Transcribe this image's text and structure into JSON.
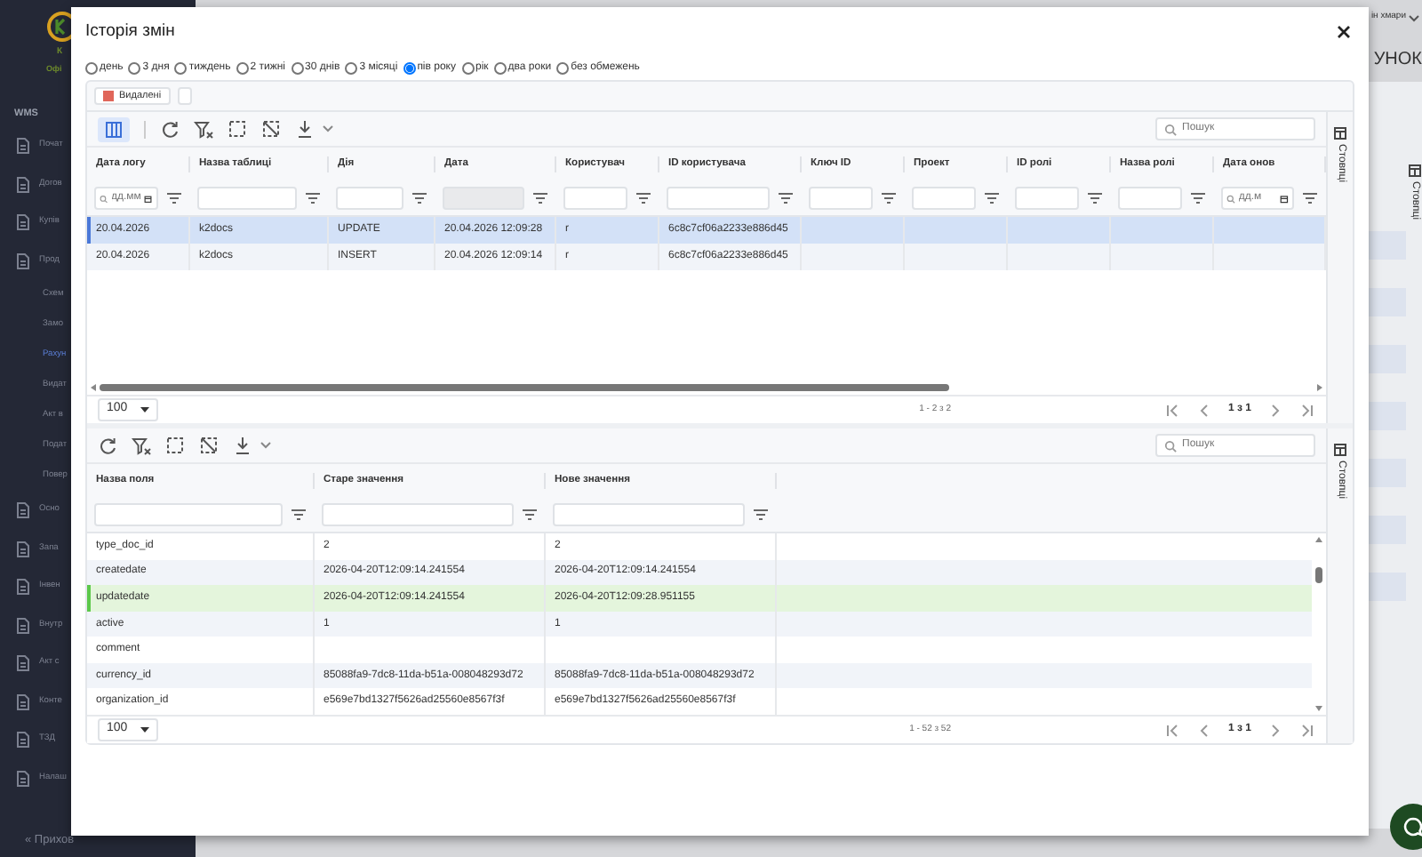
{
  "sidebar": {
    "logo_texts": [
      "К",
      "Офі"
    ],
    "items": [
      {
        "label": "WMS",
        "kind": "section",
        "selected": false
      },
      {
        "label": "Почат",
        "kind": "item",
        "selected": false
      },
      {
        "label": "Догов",
        "kind": "item",
        "selected": false
      },
      {
        "label": "Купів",
        "kind": "item",
        "selected": false
      },
      {
        "label": "Прод",
        "kind": "item",
        "selected": false
      },
      {
        "label": "Схем",
        "kind": "sub",
        "selected": false
      },
      {
        "label": "Замо",
        "kind": "sub",
        "selected": false
      },
      {
        "label": "Рахун",
        "kind": "sub",
        "selected": true
      },
      {
        "label": "Видат",
        "kind": "sub",
        "selected": false
      },
      {
        "label": "Акт в",
        "kind": "sub",
        "selected": false
      },
      {
        "label": "Подат",
        "kind": "sub",
        "selected": false
      },
      {
        "label": "Повер",
        "kind": "sub",
        "selected": false
      },
      {
        "label": "Осно",
        "kind": "item",
        "selected": false
      },
      {
        "label": "Запа",
        "kind": "item",
        "selected": false
      },
      {
        "label": "Інвен",
        "kind": "item",
        "selected": false
      },
      {
        "label": "Внутр",
        "kind": "item",
        "selected": false
      },
      {
        "label": "Акт с",
        "kind": "item",
        "selected": false
      },
      {
        "label": "Конте",
        "kind": "item",
        "selected": false
      },
      {
        "label": "ТЗД",
        "kind": "item",
        "selected": false
      },
      {
        "label": "Налаш",
        "kind": "item",
        "selected": false
      }
    ],
    "footer": "« Прихов"
  },
  "background": {
    "user_menu": "ін хмари",
    "page_title": "УНОК",
    "columns_tab": "Стовпці"
  },
  "dialog": {
    "title": "Історія змін",
    "periods": [
      {
        "label": "день",
        "selected": false
      },
      {
        "label": "3 дня",
        "selected": false
      },
      {
        "label": "тиждень",
        "selected": false
      },
      {
        "label": "2 тижні",
        "selected": false
      },
      {
        "label": "30 днів",
        "selected": false
      },
      {
        "label": "3 місяці",
        "selected": false
      },
      {
        "label": "пів року",
        "selected": true
      },
      {
        "label": "рік",
        "selected": false
      },
      {
        "label": "два роки",
        "selected": false
      },
      {
        "label": "без обмежень",
        "selected": false
      }
    ],
    "deleted_filter": "Видалені",
    "log_grid": {
      "column_toggle_on": true,
      "search_placeholder": "Пошук",
      "columns": [
        {
          "label": "Дата логу",
          "kind": "date",
          "placeholder": "дд.мм"
        },
        {
          "label": "Назва таблиці",
          "kind": "text"
        },
        {
          "label": "Дія",
          "kind": "text"
        },
        {
          "label": "Дата",
          "kind": "disabled"
        },
        {
          "label": "Користувач",
          "kind": "text"
        },
        {
          "label": "ID користувача",
          "kind": "text"
        },
        {
          "label": "Ключ ID",
          "kind": "text"
        },
        {
          "label": "Проект",
          "kind": "text"
        },
        {
          "label": "ID ролі",
          "kind": "text"
        },
        {
          "label": "Назва ролі",
          "kind": "text"
        },
        {
          "label": "Дата онов",
          "kind": "date",
          "placeholder": "дд.м"
        }
      ],
      "rows": [
        {
          "selected": true,
          "cells": [
            "20.04.2026",
            "k2docs",
            "UPDATE",
            "20.04.2026 12:09:28",
            "r",
            "6c8c7cf06a2233e886d45"
          ]
        },
        {
          "selected": false,
          "cells": [
            "20.04.2026",
            "k2docs",
            "INSERT",
            "20.04.2026 12:09:14",
            "r",
            "6c8c7cf06a2233e886d45"
          ]
        }
      ],
      "page_size": "100",
      "range": "1 - 2 з 2",
      "page": "1 з 1",
      "columns_tab": "Стовпці"
    },
    "detail_grid": {
      "search_placeholder": "Пошук",
      "columns": [
        {
          "label": "Назва поля",
          "kind": "text"
        },
        {
          "label": "Старе значення",
          "kind": "text"
        },
        {
          "label": "Нове значення",
          "kind": "text"
        }
      ],
      "rows": [
        {
          "changed": false,
          "cells": [
            "type_doc_id",
            "2",
            "2"
          ]
        },
        {
          "changed": false,
          "cells": [
            "createdate",
            "2026-04-20T12:09:14.241554",
            "2026-04-20T12:09:14.241554"
          ]
        },
        {
          "changed": true,
          "cells": [
            "updatedate",
            "2026-04-20T12:09:14.241554",
            "2026-04-20T12:09:28.951155"
          ]
        },
        {
          "changed": false,
          "cells": [
            "active",
            "1",
            "1"
          ]
        },
        {
          "changed": false,
          "cells": [
            "comment",
            "",
            ""
          ]
        },
        {
          "changed": false,
          "cells": [
            "currency_id",
            "85088fa9-7dc8-11da-b51a-008048293d72",
            "85088fa9-7dc8-11da-b51a-008048293d72"
          ]
        },
        {
          "changed": false,
          "cells": [
            "organization_id",
            "e569e7bd1327f5626ad25560e8567f3f",
            "e569e7bd1327f5626ad25560e8567f3f"
          ]
        }
      ],
      "page_size": "100",
      "range": "1 - 52 з 52",
      "page": "1 з 1",
      "columns_tab": "Стовпці"
    }
  }
}
